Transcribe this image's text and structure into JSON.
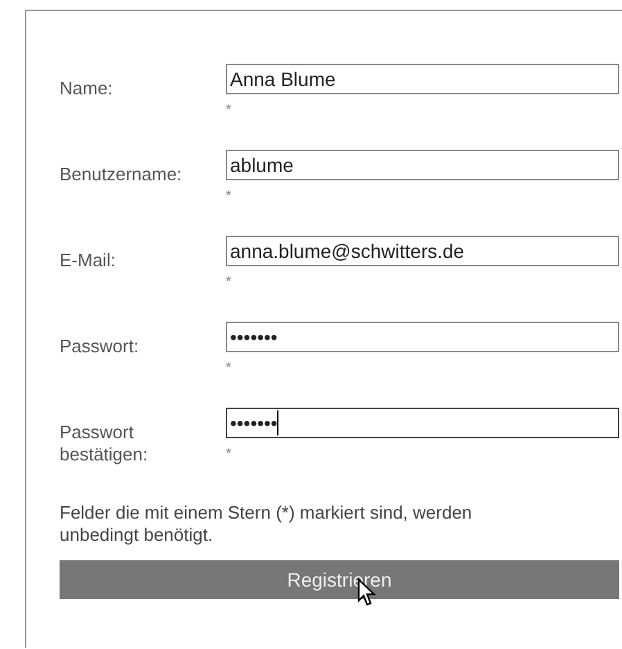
{
  "fields": [
    {
      "label": "Name:",
      "value": "Anna Blume",
      "required_mark": "*",
      "focused": false
    },
    {
      "label": "Benutzername:",
      "value": "ablume",
      "required_mark": "*",
      "focused": false
    },
    {
      "label": "E-Mail:",
      "value": "anna.blume@schwitters.de",
      "required_mark": "*",
      "focused": false
    },
    {
      "label": "Passwort:",
      "value": "•••••••",
      "required_mark": "*",
      "focused": false
    },
    {
      "label": "Passwort bestätigen:",
      "value": "•••••••",
      "required_mark": "*",
      "focused": true
    }
  ],
  "note": "Felder die mit einem Stern (*) markiert sind, werden unbedingt benötigt.",
  "submit_button": "Registrieren"
}
